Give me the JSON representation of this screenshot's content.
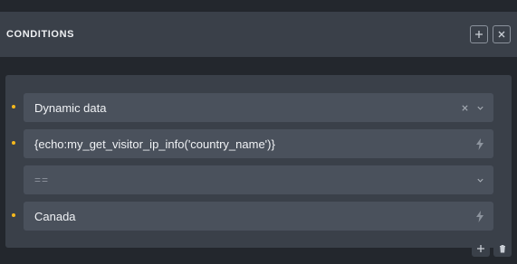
{
  "header": {
    "title": "CONDITIONS",
    "add_icon": "plus-icon",
    "close_icon": "close-icon"
  },
  "condition": {
    "key": {
      "value": "Dynamic data",
      "clear_icon": "close-icon",
      "dropdown_icon": "chevron-down-icon"
    },
    "dynamic_tag": {
      "value": "{echo:my_get_visitor_ip_info('country_name')}",
      "icon": "bolt-icon"
    },
    "compare": {
      "placeholder": "==",
      "dropdown_icon": "chevron-down-icon"
    },
    "value": {
      "value": "Canada",
      "icon": "bolt-icon"
    }
  },
  "footer": {
    "add_icon": "plus-icon",
    "delete_icon": "trash-icon"
  },
  "colors": {
    "bullet": "#f5b81c",
    "panel": "#3a4049",
    "field": "#4a515c",
    "background": "#23272d"
  }
}
